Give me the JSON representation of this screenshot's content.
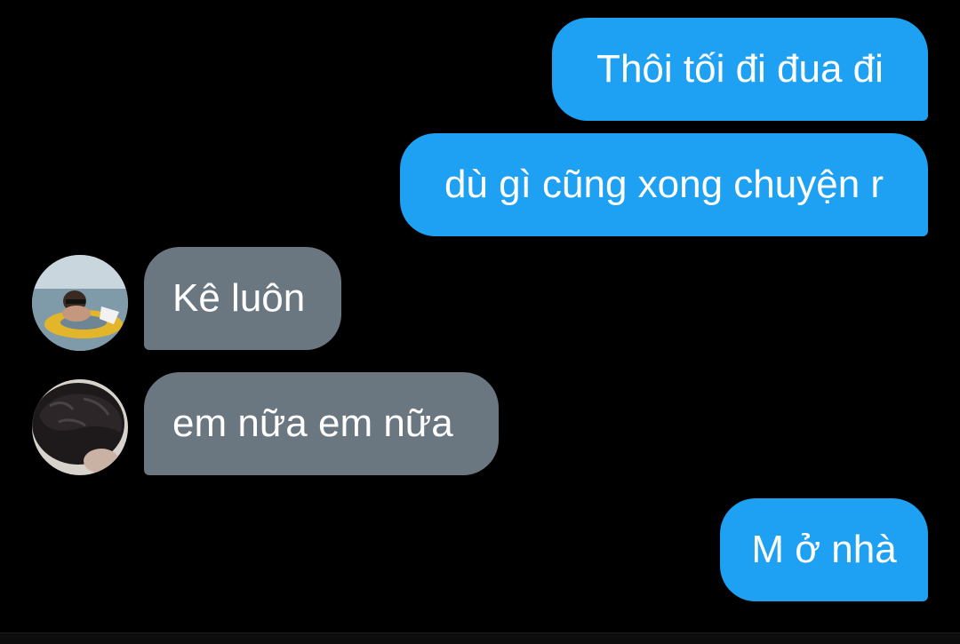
{
  "conversation": {
    "messages": [
      {
        "direction": "outgoing",
        "text": "Thôi tối đi đua đi"
      },
      {
        "direction": "outgoing",
        "text": "dù gì cũng xong chuyện r"
      },
      {
        "direction": "incoming",
        "sender_avatar": "swimmer-photo-avatar",
        "text": "Kê luôn"
      },
      {
        "direction": "incoming",
        "sender_avatar": "dark-hair-photo-avatar",
        "text": "em nữa em nữa"
      },
      {
        "direction": "outgoing",
        "text": "M ở nhà"
      }
    ]
  },
  "colors": {
    "background": "#000000",
    "outgoing_bubble": "#1ea1f2",
    "incoming_bubble": "#6b7780",
    "bubble_text": "#ffffff"
  }
}
